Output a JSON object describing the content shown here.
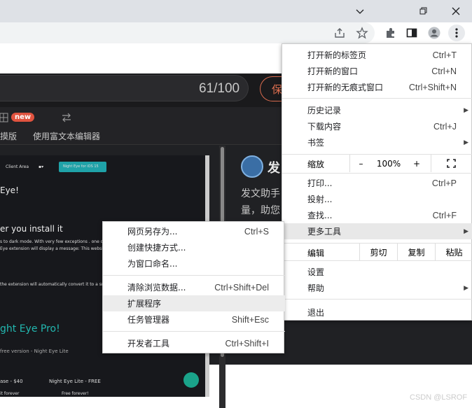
{
  "window": {
    "minimize_icon": "chevron-down-icon",
    "restore_icon": "restore-icon",
    "close_icon": "close-icon"
  },
  "toolbar": {
    "share_icon": "share-icon",
    "bookmark_icon": "star-icon",
    "extensions_icon": "puzzle-icon",
    "sidepanel_icon": "side-panel-icon",
    "profile_icon": "profile-icon",
    "menu_icon": "kebab-menu-icon"
  },
  "page": {
    "counter": "61/100",
    "save_label": "保",
    "new_badge": "new",
    "tool1_label": "摸版",
    "tool2_label": "使用富文本编辑器",
    "right_title": "发",
    "right_line1": "发文助手",
    "right_line2": "量，助您",
    "embed": {
      "nav1": "Client Area",
      "nav_btn": "Night Eye for iOS 15",
      "heading1": "Eye!",
      "heading2": "er you install it",
      "para1": "s to dark mode. With very few exceptions . one of whic",
      "para2": "Eye extension will display a message: This website is",
      "para3": "the extension will automatically convert it to a smooth",
      "pro": "ght Eye Pro!",
      "free": "free version - Night Eye Lite",
      "price1": "ase - $40",
      "price2": "Night Eye Lite - FREE",
      "foot1": "it forever",
      "foot2": "Free forever!"
    },
    "watermark": "CSDN @LSROF"
  },
  "menu": {
    "items_top": [
      {
        "label": "打开新的标签页",
        "shortcut": "Ctrl+T"
      },
      {
        "label": "打开新的窗口",
        "shortcut": "Ctrl+N"
      },
      {
        "label": "打开新的无痕式窗口",
        "shortcut": "Ctrl+Shift+N"
      }
    ],
    "items_history": [
      {
        "label": "历史记录",
        "shortcut": ""
      },
      {
        "label": "下载内容",
        "shortcut": "Ctrl+J"
      },
      {
        "label": "书签",
        "shortcut": ""
      }
    ],
    "zoom": {
      "label": "缩放",
      "minus": "–",
      "value": "100%",
      "plus": "+"
    },
    "items_tools": [
      {
        "label": "打印...",
        "shortcut": "Ctrl+P"
      },
      {
        "label": "投射...",
        "shortcut": ""
      },
      {
        "label": "查找...",
        "shortcut": "Ctrl+F"
      },
      {
        "label": "更多工具",
        "shortcut": ""
      }
    ],
    "edit": {
      "label": "编辑",
      "cut": "剪切",
      "copy": "复制",
      "paste": "粘贴"
    },
    "items_settings": [
      {
        "label": "设置",
        "shortcut": ""
      },
      {
        "label": "帮助",
        "shortcut": ""
      }
    ],
    "exit": "退出"
  },
  "submenu": {
    "items": [
      {
        "label": "网页另存为...",
        "shortcut": "Ctrl+S"
      },
      {
        "label": "创建快捷方式...",
        "shortcut": ""
      },
      {
        "label": "为窗口命名...",
        "shortcut": ""
      },
      {
        "label": "清除浏览数据...",
        "shortcut": "Ctrl+Shift+Del"
      },
      {
        "label": "扩展程序",
        "shortcut": ""
      },
      {
        "label": "任务管理器",
        "shortcut": "Shift+Esc"
      },
      {
        "label": "开发者工具",
        "shortcut": "Ctrl+Shift+I"
      }
    ]
  }
}
